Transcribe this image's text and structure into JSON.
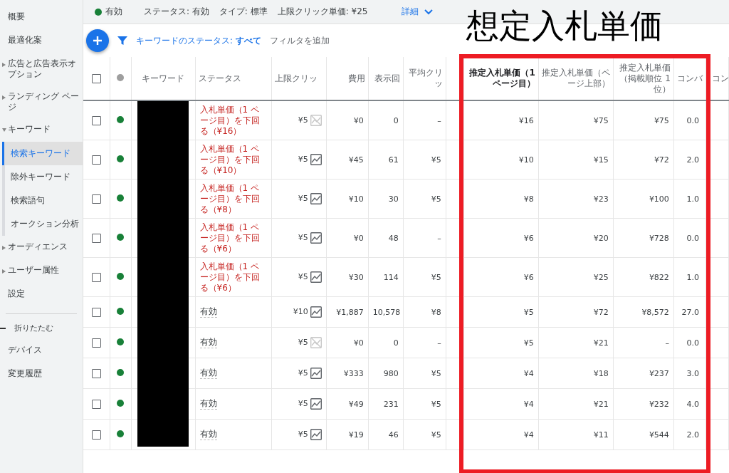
{
  "sidebar": {
    "items": [
      {
        "label": "概要",
        "kind": "link",
        "selected": false
      },
      {
        "label": "最適化案",
        "kind": "link",
        "selected": false
      },
      {
        "label": "広告と広告表示オプション",
        "kind": "group",
        "expanded": false,
        "selected": false
      },
      {
        "label": "ランディング ページ",
        "kind": "group",
        "expanded": false,
        "selected": false
      },
      {
        "label": "キーワード",
        "kind": "group",
        "expanded": true,
        "selected": false,
        "children": [
          {
            "label": "検索キーワード",
            "selected": true
          },
          {
            "label": "除外キーワード",
            "selected": false
          },
          {
            "label": "検索語句",
            "selected": false
          },
          {
            "label": "オークション分析",
            "selected": false
          }
        ]
      },
      {
        "label": "オーディエンス",
        "kind": "group",
        "expanded": false,
        "selected": false
      },
      {
        "label": "ユーザー属性",
        "kind": "group",
        "expanded": false,
        "selected": false
      },
      {
        "label": "設定",
        "kind": "link",
        "selected": false
      }
    ],
    "collapse": "折りたたむ",
    "more_items": [
      {
        "label": "デバイス",
        "selected": false
      },
      {
        "label": "変更履歴",
        "selected": false
      }
    ]
  },
  "summary_bar": {
    "state": "有効",
    "status": "ステータス: 有効",
    "type": "タイプ: 標準",
    "max_cpc": "上限クリック単価: ¥25",
    "details_link": "詳細"
  },
  "toolbar": {
    "filter": "キーワードのステータス: **すべて**",
    "add_filter": "フィルタを追加"
  },
  "table": {
    "select_all_checked": false,
    "columns": [
      {
        "label": "キーワード",
        "sorted": false
      },
      {
        "label": "ステータス",
        "sorted": false
      },
      {
        "label": "上限クリッ",
        "sorted": false
      },
      {
        "label": "費用",
        "sorted": false
      },
      {
        "label": "表示回",
        "sorted": false
      },
      {
        "label": "平均クリッ",
        "sorted": false
      },
      {
        "label": "推定入札単価（1 ページ目）",
        "sorted": true
      },
      {
        "label": "推定入札単価（ページ上部）",
        "sorted": false
      },
      {
        "label": "推定入札単価（掲載順位 1 位）",
        "sorted": false
      },
      {
        "label": "コンバ",
        "sorted": false
      },
      {
        "label": "コン",
        "sorted": false
      }
    ],
    "rows": [
      {
        "checked": false,
        "status": "入札単価（1 ページ目）を下回る（¥16）",
        "warning": true,
        "max_cpc": "¥5",
        "trend": false,
        "cost": "¥0",
        "impressions": "0",
        "avg_cpc": "–",
        "est_first": "¥16",
        "est_top": "¥75",
        "est_pos1": "¥75",
        "conv": "0.0"
      },
      {
        "checked": false,
        "status": "入札単価（1 ページ目）を下回る（¥10）",
        "warning": true,
        "max_cpc": "¥5",
        "trend": true,
        "cost": "¥45",
        "impressions": "61",
        "avg_cpc": "¥5",
        "est_first": "¥10",
        "est_top": "¥15",
        "est_pos1": "¥72",
        "conv": "2.0"
      },
      {
        "checked": false,
        "status": "入札単価（1 ページ目）を下回る（¥8）",
        "warning": true,
        "max_cpc": "¥5",
        "trend": true,
        "cost": "¥10",
        "impressions": "30",
        "avg_cpc": "¥5",
        "est_first": "¥8",
        "est_top": "¥23",
        "est_pos1": "¥100",
        "conv": "1.0"
      },
      {
        "checked": false,
        "status": "入札単価（1 ページ目）を下回る（¥6）",
        "warning": true,
        "max_cpc": "¥5",
        "trend": true,
        "cost": "¥0",
        "impressions": "48",
        "avg_cpc": "–",
        "est_first": "¥6",
        "est_top": "¥20",
        "est_pos1": "¥728",
        "conv": "0.0"
      },
      {
        "checked": false,
        "status": "入札単価（1 ページ目）を下回る（¥6）",
        "warning": true,
        "max_cpc": "¥5",
        "trend": true,
        "cost": "¥30",
        "impressions": "114",
        "avg_cpc": "¥5",
        "est_first": "¥6",
        "est_top": "¥25",
        "est_pos1": "¥822",
        "conv": "1.0"
      },
      {
        "checked": false,
        "status": "有効",
        "warning": false,
        "max_cpc": "¥10",
        "trend": true,
        "cost": "¥1,887",
        "impressions": "10,578",
        "avg_cpc": "¥8",
        "est_first": "¥5",
        "est_top": "¥72",
        "est_pos1": "¥8,572",
        "conv": "27.0"
      },
      {
        "checked": false,
        "status": "有効",
        "warning": false,
        "max_cpc": "¥5",
        "trend": false,
        "cost": "¥0",
        "impressions": "0",
        "avg_cpc": "–",
        "est_first": "¥5",
        "est_top": "¥21",
        "est_pos1": "–",
        "conv": "0.0"
      },
      {
        "checked": false,
        "status": "有効",
        "warning": false,
        "max_cpc": "¥5",
        "trend": true,
        "cost": "¥333",
        "impressions": "980",
        "avg_cpc": "¥5",
        "est_first": "¥4",
        "est_top": "¥18",
        "est_pos1": "¥237",
        "conv": "3.0"
      },
      {
        "checked": false,
        "status": "有効",
        "warning": false,
        "max_cpc": "¥5",
        "trend": true,
        "cost": "¥49",
        "impressions": "231",
        "avg_cpc": "¥5",
        "est_first": "¥4",
        "est_top": "¥21",
        "est_pos1": "¥232",
        "conv": "4.0"
      },
      {
        "checked": false,
        "status": "有効",
        "warning": false,
        "max_cpc": "¥5",
        "trend": true,
        "cost": "¥19",
        "impressions": "46",
        "avg_cpc": "¥5",
        "est_first": "¥4",
        "est_top": "¥11",
        "est_pos1": "¥544",
        "conv": "2.0"
      }
    ]
  },
  "annotation": {
    "title": "想定入札単価"
  }
}
